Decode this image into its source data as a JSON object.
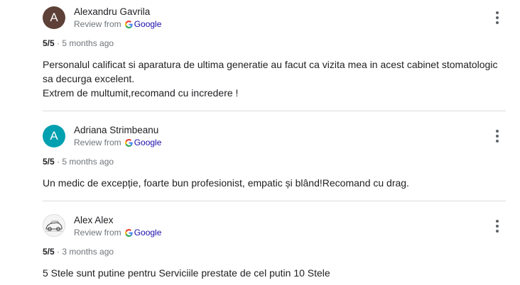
{
  "reviews": [
    {
      "initial": "A",
      "avatar_color": "#5d4037",
      "author": "Alexandru Gavrila",
      "source_prefix": "Review from",
      "source_brand": "Google",
      "score": "5/5",
      "separator": " · ",
      "date": "5 months ago",
      "lines": [
        "Personalul calificat si aparatura de ultima generatie au facut ca vizita mea in acest cabinet stomatologic",
        "sa decurga excelent.",
        "Extrem de multumit,recomand cu incredere !"
      ],
      "menu_icon": "more-vert-icon"
    },
    {
      "initial": "A",
      "avatar_color": "#00a0b0",
      "author": "Adriana Strimbeanu",
      "source_prefix": "Review from",
      "source_brand": "Google",
      "score": "5/5",
      "separator": " · ",
      "date": "5 months ago",
      "lines": [
        "Un medic de excepție, foarte bun profesionist, empatic și blând!Recomand cu drag."
      ],
      "menu_icon": "more-vert-icon"
    },
    {
      "avatar_type": "photo",
      "author": "Alex Alex",
      "source_prefix": "Review from",
      "source_brand": "Google",
      "score": "5/5",
      "separator": " · ",
      "date": "3 months ago",
      "lines": [
        "5 Stele sunt putine pentru Serviciile prestate de cel putin 10 Stele"
      ],
      "menu_icon": "more-vert-icon"
    }
  ]
}
